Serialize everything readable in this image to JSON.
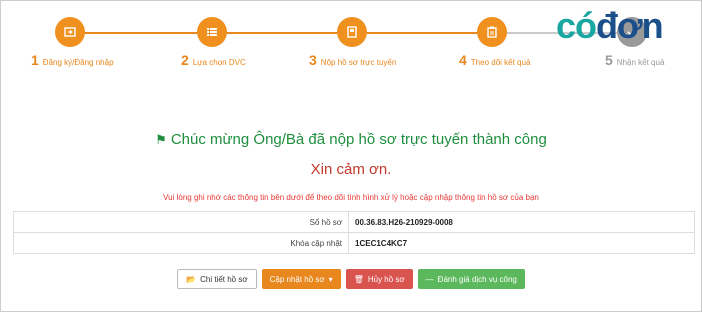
{
  "logo": {
    "part1": "có",
    "part2": "đơn"
  },
  "steps": [
    {
      "num": "1",
      "label": "Đăng ký/Đăng nhập",
      "icon": "login-icon"
    },
    {
      "num": "2",
      "label": "Lựa chọn DVC",
      "icon": "list-icon"
    },
    {
      "num": "3",
      "label": "Nộp hồ sơ trực tuyến",
      "icon": "file-upload-icon"
    },
    {
      "num": "4",
      "label": "Theo dõi kết quả",
      "icon": "clipboard-icon"
    },
    {
      "num": "5",
      "label": "Nhận kết quả",
      "icon": "receive-icon"
    }
  ],
  "message": {
    "success": "Chúc mừng Ông/Bà đã nộp hồ sơ trực tuyến thành công",
    "thanks": "Xin cảm ơn.",
    "note": "Vui lòng ghi nhớ các thông tin bên dưới để theo dõi tình hình xử lý hoặc cập nhập thông tin hồ sơ của bạn"
  },
  "info": [
    {
      "key": "Số hồ sơ",
      "value": "00.36.83.H26-210929-0008"
    },
    {
      "key": "Khóa cập nhật",
      "value": "1CEC1C4KC7"
    }
  ],
  "buttons": {
    "detail": "Chi tiết hồ sơ",
    "update": "Cập nhật hồ sơ",
    "cancel": "Hủy hồ sơ",
    "rate": "Đánh giá dịch vụ công"
  },
  "colors": {
    "accent": "#e8871e",
    "success": "#1e8e3e",
    "danger": "#d9534f",
    "ok": "#5cb85c"
  }
}
